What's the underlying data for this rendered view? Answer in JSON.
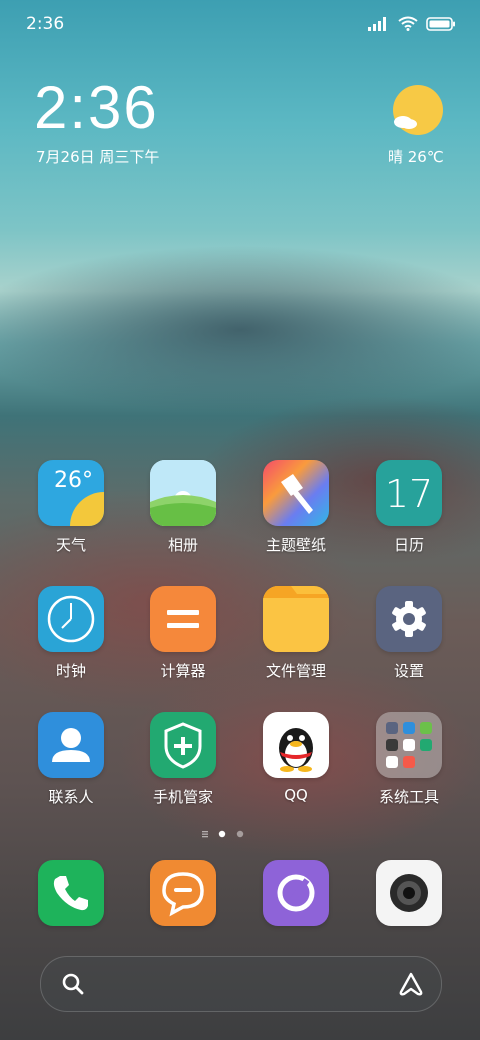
{
  "status": {
    "time": "2:36"
  },
  "clock": {
    "time": "2:36",
    "date": "7月26日 周三下午"
  },
  "weather": {
    "text": "晴 26℃",
    "icon": "sun-cloud-icon"
  },
  "apps": [
    {
      "label": "天气",
      "icon": "weather-icon",
      "value": "26°"
    },
    {
      "label": "相册",
      "icon": "gallery-icon"
    },
    {
      "label": "主题壁纸",
      "icon": "themes-icon"
    },
    {
      "label": "日历",
      "icon": "calendar-icon",
      "value": "17"
    },
    {
      "label": "时钟",
      "icon": "clock-icon"
    },
    {
      "label": "计算器",
      "icon": "calculator-icon"
    },
    {
      "label": "文件管理",
      "icon": "folder-icon"
    },
    {
      "label": "设置",
      "icon": "gear-icon"
    },
    {
      "label": "联系人",
      "icon": "contacts-icon"
    },
    {
      "label": "手机管家",
      "icon": "security-icon"
    },
    {
      "label": "QQ",
      "icon": "qq-icon"
    },
    {
      "label": "系统工具",
      "icon": "system-tools-folder-icon"
    }
  ],
  "dock": [
    {
      "icon": "phone-icon"
    },
    {
      "icon": "messages-icon"
    },
    {
      "icon": "browser-icon"
    },
    {
      "icon": "camera-icon"
    }
  ],
  "pages": {
    "count": 2,
    "current": 1
  },
  "colors": {
    "weather_bg": "#2ea7e0",
    "gallery_bg": "#8ed36a",
    "calendar_bg": "#27a29b",
    "clock_bg": "#2aa4d6",
    "calculator_bg": "#f5883b",
    "folder_bg": "#fbbf3b",
    "settings_bg": "#5a6480",
    "contacts_bg": "#2f8fdc",
    "security_bg": "#22a971",
    "phone_bg": "#1eb35b",
    "messages_bg": "#f08a32",
    "browser_bg": "#8e63d8"
  }
}
